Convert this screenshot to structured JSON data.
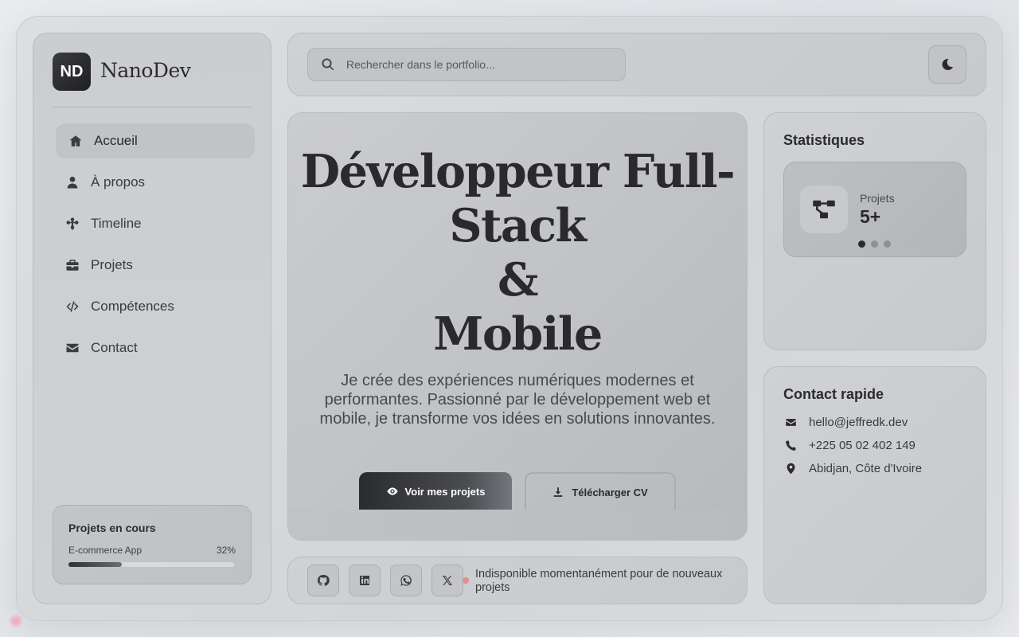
{
  "brand": {
    "initials": "ND",
    "name": "NanoDev"
  },
  "sidebar": {
    "items": [
      {
        "label": "Accueil",
        "icon": "home-icon",
        "active": true
      },
      {
        "label": "À propos",
        "icon": "user-icon"
      },
      {
        "label": "Timeline",
        "icon": "timeline-icon"
      },
      {
        "label": "Projets",
        "icon": "briefcase-icon"
      },
      {
        "label": "Compétences",
        "icon": "code-icon"
      },
      {
        "label": "Contact",
        "icon": "envelope-icon"
      }
    ],
    "progress": {
      "title": "Projets en cours",
      "name": "E-commerce App",
      "percent_label": "32%",
      "fraction": 0.32
    }
  },
  "search": {
    "placeholder": "Rechercher dans le portfolio..."
  },
  "theme_toggle": {
    "icon": "moon-icon"
  },
  "hero": {
    "title_line1": "Développeur Full-",
    "title_line2": "Stack",
    "title_line3": "&",
    "title_line4": "Mobile",
    "description": "Je crée des expériences numériques modernes et performantes. Passionné par le développement web et mobile, je transforme vos idées en solutions innovantes.",
    "primary_button": "Voir mes projets",
    "secondary_button": "Télécharger CV"
  },
  "social": {
    "links": [
      "github-icon",
      "linkedin-icon",
      "whatsapp-icon",
      "x-icon"
    ],
    "status": "Indisponible momentanément pour de nouveaux projets",
    "status_color": "#e88a8a"
  },
  "stats": {
    "title": "Statistiques",
    "card": {
      "label": "Projets",
      "value": "5+",
      "icon": "project-diagram-icon"
    },
    "carousel_dots": 3,
    "active_dot": 0
  },
  "contact": {
    "title": "Contact rapide",
    "email": "hello@jeffredk.dev",
    "phone": "+225 05 02 402 149",
    "location": "Abidjan, Côte d'Ivoire"
  }
}
